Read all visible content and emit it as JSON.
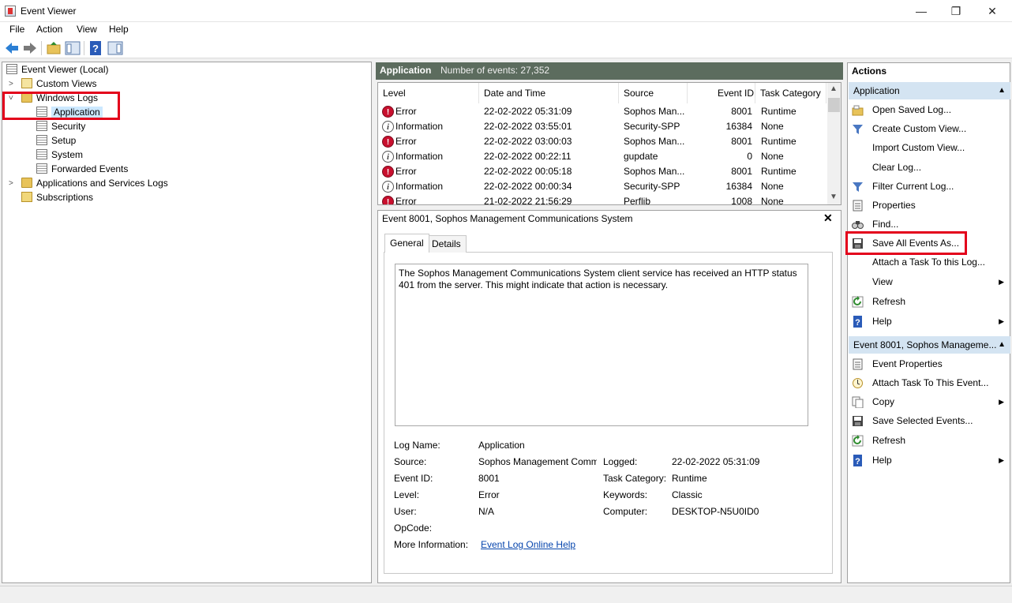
{
  "window": {
    "title": "Event Viewer",
    "minimize": "—",
    "maximize": "❐",
    "close": "✕"
  },
  "menu": [
    "File",
    "Action",
    "View",
    "Help"
  ],
  "tree": {
    "root": "Event Viewer (Local)",
    "custom_views": "Custom Views",
    "windows_logs": "Windows Logs",
    "application": "Application",
    "security": "Security",
    "setup": "Setup",
    "system": "System",
    "forwarded": "Forwarded Events",
    "app_services": "Applications and Services Logs",
    "subscriptions": "Subscriptions"
  },
  "center": {
    "log_name": "Application",
    "count_label": "Number of events: 27,352",
    "columns": [
      "Level",
      "Date and Time",
      "Source",
      "Event ID",
      "Task Category"
    ],
    "rows": [
      {
        "level": "Error",
        "date": "22-02-2022 05:31:09",
        "source": "Sophos Man...",
        "id": "8001",
        "task": "Runtime"
      },
      {
        "level": "Information",
        "date": "22-02-2022 03:55:01",
        "source": "Security-SPP",
        "id": "16384",
        "task": "None"
      },
      {
        "level": "Error",
        "date": "22-02-2022 03:00:03",
        "source": "Sophos Man...",
        "id": "8001",
        "task": "Runtime"
      },
      {
        "level": "Information",
        "date": "22-02-2022 00:22:11",
        "source": "gupdate",
        "id": "0",
        "task": "None"
      },
      {
        "level": "Error",
        "date": "22-02-2022 00:05:18",
        "source": "Sophos Man...",
        "id": "8001",
        "task": "Runtime"
      },
      {
        "level": "Information",
        "date": "22-02-2022 00:00:34",
        "source": "Security-SPP",
        "id": "16384",
        "task": "None"
      },
      {
        "level": "Error",
        "date": "21-02-2022 21:56:29",
        "source": "Perflib",
        "id": "1008",
        "task": "None"
      }
    ]
  },
  "detail": {
    "title": "Event 8001, Sophos Management Communications System",
    "close": "✕",
    "tabs": [
      "General",
      "Details"
    ],
    "message": "The Sophos Management Communications System client service has received an HTTP status 401 from the server. This might indicate that action is necessary.",
    "labels": {
      "log_name": "Log Name:",
      "source": "Source:",
      "event_id": "Event ID:",
      "level": "Level:",
      "user": "User:",
      "opcode": "OpCode:",
      "more_info": "More Information:",
      "logged": "Logged:",
      "task_category": "Task Category:",
      "keywords": "Keywords:",
      "computer": "Computer:"
    },
    "values": {
      "log_name": "Application",
      "source": "Sophos Management Comm",
      "event_id": "8001",
      "level": "Error",
      "user": "N/A",
      "opcode": "",
      "more_info": "Event Log Online Help",
      "logged": "22-02-2022 05:31:09",
      "task_category": "Runtime",
      "keywords": "Classic",
      "computer": "DESKTOP-N5U0ID0"
    }
  },
  "actions": {
    "title": "Actions",
    "section1": "Application",
    "section1_items": [
      "Open Saved Log...",
      "Create Custom View...",
      "Import Custom View...",
      "Clear Log...",
      "Filter Current Log...",
      "Properties",
      "Find...",
      "Save All Events As...",
      "Attach a Task To this Log...",
      "View",
      "Refresh",
      "Help"
    ],
    "section2": "Event 8001, Sophos Manageme...",
    "section2_items": [
      "Event Properties",
      "Attach Task To This Event...",
      "Copy",
      "Save Selected Events...",
      "Refresh",
      "Help"
    ]
  },
  "colors": {
    "highlight_box": "#e3001b",
    "section_bg": "#d4e4f2",
    "header_bg": "#5c6c5e",
    "selection": "#cce8ff"
  }
}
